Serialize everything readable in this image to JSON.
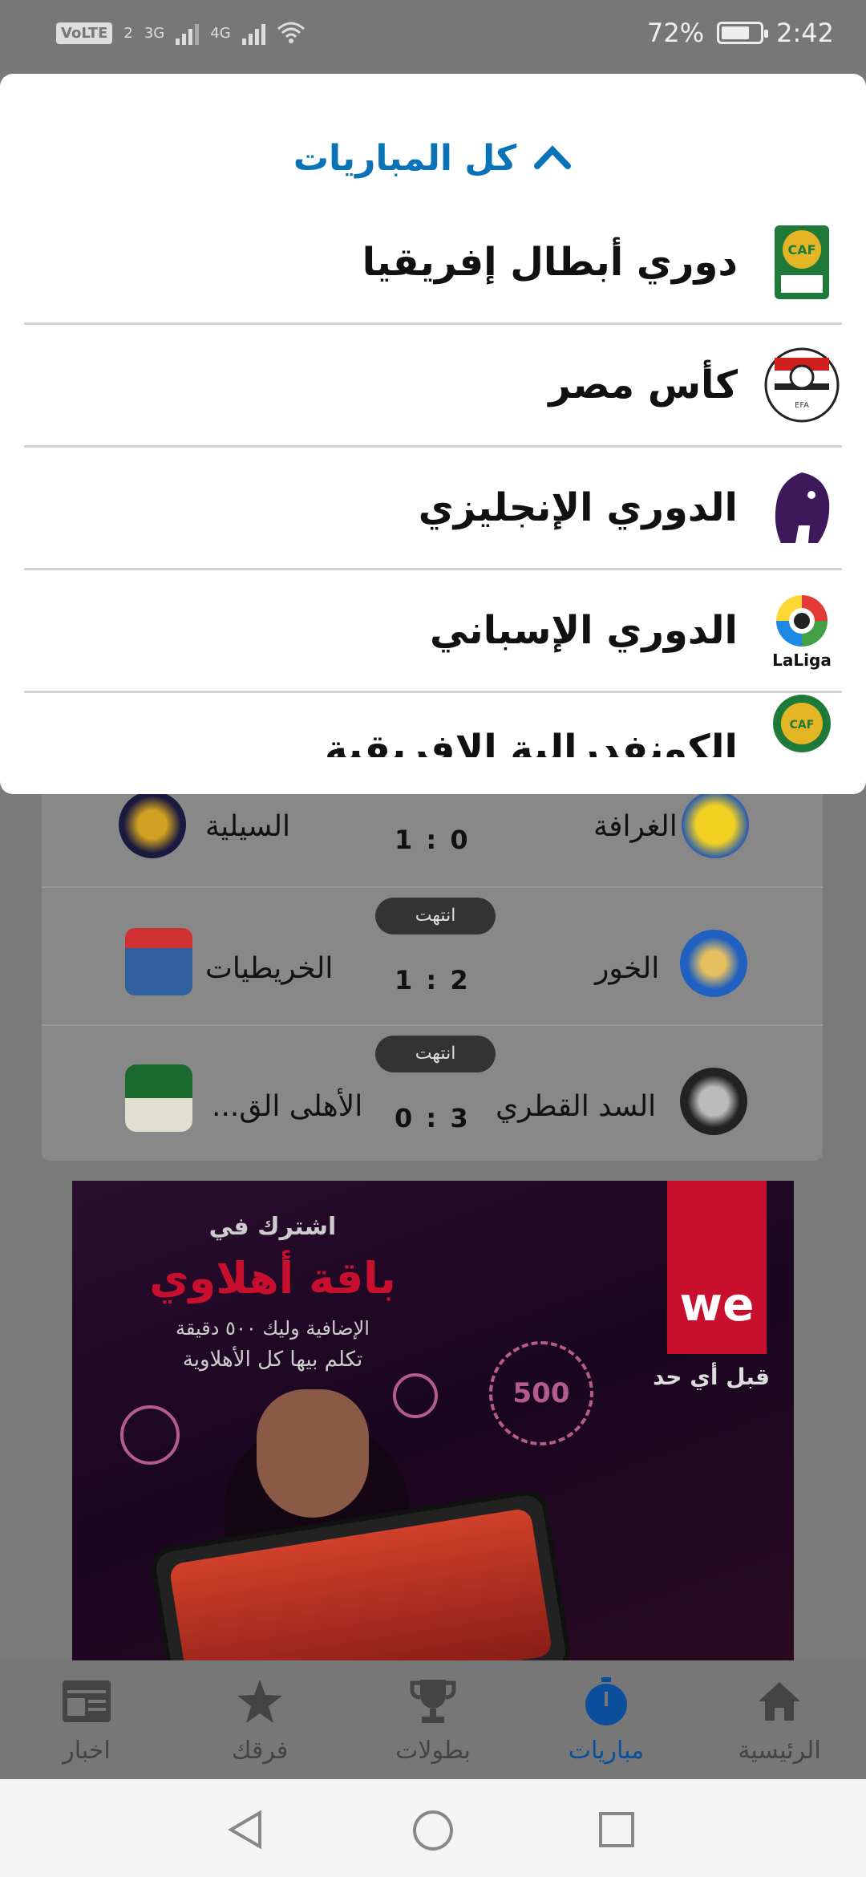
{
  "status_bar": {
    "volte": "VoLTE",
    "sim": "2",
    "net1": "3G",
    "net2": "4G",
    "battery": "72%",
    "time": "2:42"
  },
  "dropdown": {
    "title": "كل المباريات",
    "leagues": [
      {
        "name": "دوري أبطال إفريقيا",
        "icon": "caf-champions-league-logo"
      },
      {
        "name": "كأس مصر",
        "icon": "egypt-fa-logo"
      },
      {
        "name": "الدوري الإنجليزي",
        "icon": "premier-league-lion-logo"
      },
      {
        "name": "الدوري الإسباني",
        "icon": "laliga-logo",
        "logo_text": "LaLiga"
      },
      {
        "name": "الكونفدرالية الافريقية",
        "icon": "caf-confederation-cup-logo"
      }
    ]
  },
  "matches": [
    {
      "home": "الغرافة",
      "away": "السيلية",
      "score": "1 : 0",
      "status": ""
    },
    {
      "home": "الخور",
      "away": "الخريطيات",
      "score": "1 : 2",
      "status": "انتهت"
    },
    {
      "home": "السد القطري",
      "away": "الأهلى الق...",
      "score": "0 : 3",
      "status": "انتهت"
    }
  ],
  "ad": {
    "line1": "اشترك في",
    "line2": "باقة أهلاوي",
    "line3": "الإضافية وليك ٥٠٠ دقيقة",
    "line4": "تكلم بيها كل الأهلاوية",
    "brand": "we",
    "tagline": "قبل أي حد",
    "badge": "500"
  },
  "bottom_nav": [
    {
      "label": "الرئيسية",
      "icon": "home-icon",
      "active": false
    },
    {
      "label": "مباريات",
      "icon": "stopwatch-icon",
      "active": true
    },
    {
      "label": "بطولات",
      "icon": "trophy-icon",
      "active": false
    },
    {
      "label": "فرقك",
      "icon": "star-icon",
      "active": false
    },
    {
      "label": "اخبار",
      "icon": "news-icon",
      "active": false
    }
  ],
  "colors": {
    "accent": "#0a73b7",
    "active_nav": "#0a4e9c",
    "brand_red": "#c8102e"
  }
}
